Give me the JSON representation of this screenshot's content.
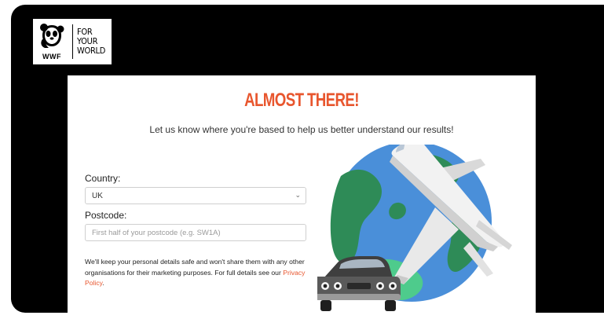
{
  "brand": {
    "name": "WWF",
    "tagline": [
      "FOR",
      "YOUR",
      "WORLD"
    ]
  },
  "page": {
    "headline": "ALMOST THERE!",
    "subtitle": "Let us know where you're based to help us better understand our results!"
  },
  "form": {
    "country_label": "Country:",
    "country_value": "UK",
    "postcode_label": "Postcode:",
    "postcode_placeholder": "First half of your postcode (e.g. SW1A)"
  },
  "notice": {
    "text": "We'll keep your personal details safe and won't share them with any other organisations for their marketing purposes. For full details see our ",
    "link": "Privacy Policy",
    "suffix": "."
  },
  "icons": {
    "logo": "wwf-panda-icon",
    "select": "chevron-down-icon",
    "illustration": [
      "globe-icon",
      "airplane-icon",
      "car-icon"
    ]
  },
  "colors": {
    "accent": "#e8562e",
    "ocean": "#4a8fd9",
    "land": "#2e8b57"
  }
}
